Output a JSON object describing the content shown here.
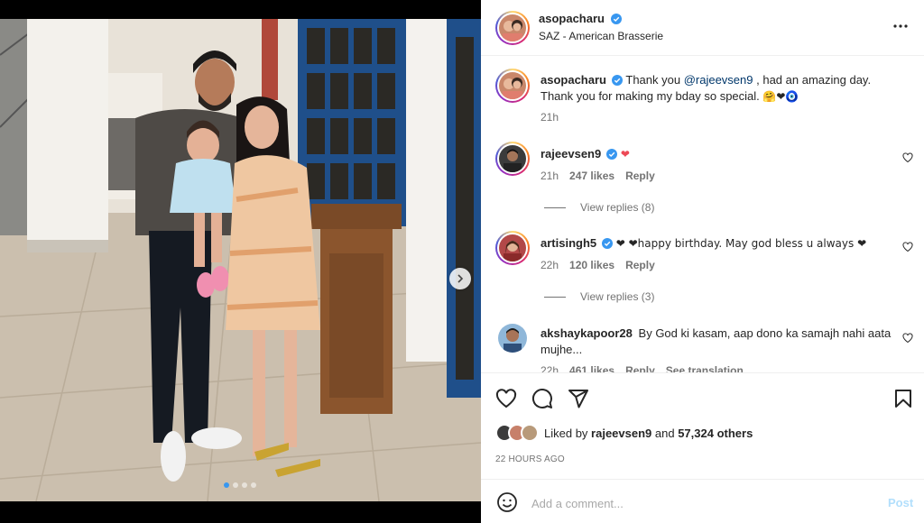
{
  "post": {
    "author": "asopacharu",
    "location": "SAZ - American Brasserie",
    "carousel": {
      "count": 4,
      "active": 1
    }
  },
  "caption": {
    "username": "asopacharu",
    "text_before": "Thank you ",
    "mention": "@rajeevsen9",
    "text_after": " , had an amazing day. Thank you for making my bday so special.",
    "emojis": "🤗❤🧿",
    "time": "21h"
  },
  "comments": [
    {
      "username": "rajeevsen9",
      "verified": true,
      "text": "❤",
      "time": "21h",
      "likes": "247 likes",
      "reply": "Reply",
      "view_replies": "View replies (8)"
    },
    {
      "username": "artisingh5",
      "verified": true,
      "text": "❤ ❤happy birthday. May god bless u always ❤",
      "time": "22h",
      "likes": "120 likes",
      "reply": "Reply",
      "view_replies": "View replies (3)"
    },
    {
      "username": "akshaykapoor28",
      "verified": false,
      "text": "By God ki kasam, aap dono ka samajh nahi aata mujhe...",
      "time": "22h",
      "likes": "461 likes",
      "reply": "Reply",
      "translation": "See translation"
    }
  ],
  "likes": {
    "prefix": "Liked by ",
    "user": "rajeevsen9",
    "middle": " and ",
    "others": "57,324 others"
  },
  "timestamp": "22 HOURS AGO",
  "add_comment": {
    "placeholder": "Add a comment...",
    "post_label": "Post"
  },
  "colors": {
    "verified": "#3897f0",
    "heart": "#ed4956",
    "post_disabled": "#b2dffc",
    "mention": "#00376b"
  },
  "icons": [
    "chevron-right-icon",
    "more-icon",
    "verified-icon",
    "heart-icon",
    "comment-icon",
    "share-icon",
    "bookmark-icon",
    "emoji-icon"
  ]
}
